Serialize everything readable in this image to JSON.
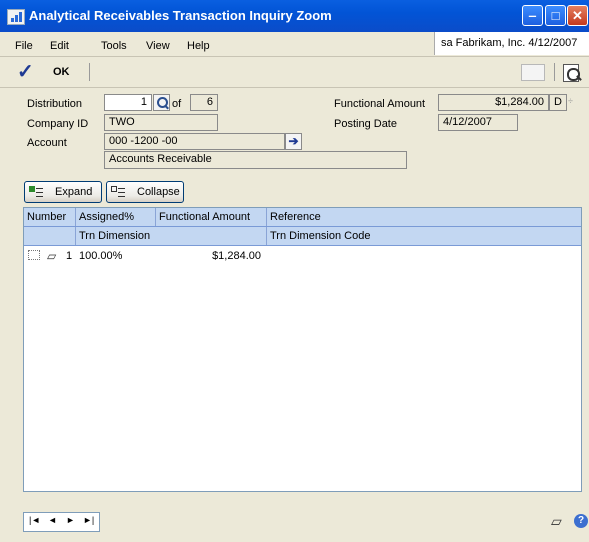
{
  "window": {
    "title": "Analytical Receivables Transaction Inquiry Zoom",
    "min_label": "‒",
    "max_label": "□",
    "close_label": "✕"
  },
  "menu": {
    "items": [
      {
        "label": "File"
      },
      {
        "label": "Edit"
      },
      {
        "label": "Tools"
      },
      {
        "label": "View"
      },
      {
        "label": "Help"
      }
    ],
    "user_info": "sa  Fabrikam, Inc.  4/12/2007"
  },
  "toolbar": {
    "ok_label": "OK",
    "ok_icon": "checkmark-icon",
    "print_icon": "print-icon"
  },
  "form": {
    "distribution_label": "Distribution",
    "distribution_value": "1",
    "of_label": "of",
    "distribution_total": "6",
    "company_id_label": "Company ID",
    "company_id_value": "TWO",
    "account_label": "Account",
    "account_value": "000 -1200 -00",
    "account_description": "Accounts Receivable",
    "functional_amount_label": "Functional Amount",
    "functional_amount_value": "$1,284.00",
    "dc_value": "D",
    "posting_date_label": "Posting Date",
    "posting_date_value": "4/12/2007"
  },
  "buttons": {
    "expand_label": "Expand",
    "collapse_label": "Collapse"
  },
  "grid": {
    "columns_row1": [
      "Number",
      "Assigned%",
      "Functional Amount",
      "Reference"
    ],
    "columns_row2": [
      "Trn Dimension",
      "Trn Dimension Code"
    ],
    "rows": [
      {
        "number": "1",
        "assigned_pct": "100.00%",
        "functional_amount": "$1,284.00",
        "reference": ""
      }
    ]
  },
  "footer": {
    "nav": [
      "first",
      "previous",
      "next",
      "last"
    ],
    "nav_glyphs": [
      "|◄",
      "◄",
      "►",
      "►|"
    ],
    "help_label": "?"
  }
}
